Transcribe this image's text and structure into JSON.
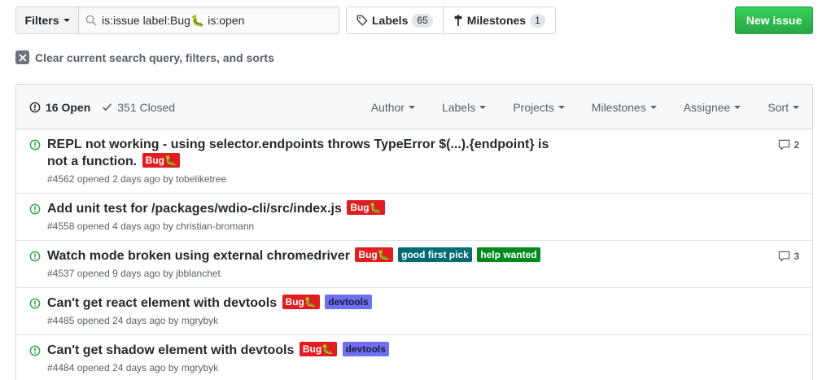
{
  "toolbar": {
    "filters_label": "Filters",
    "search_value": "is:issue label:Bug🐛 is:open",
    "labels_label": "Labels",
    "labels_count": "65",
    "milestones_label": "Milestones",
    "milestones_count": "1",
    "new_issue_label": "New issue"
  },
  "clear_query_label": "Clear current search query, filters, and sorts",
  "header": {
    "open_label": "16 Open",
    "closed_label": "351 Closed",
    "filters": [
      "Author",
      "Labels",
      "Projects",
      "Milestones",
      "Assignee",
      "Sort"
    ]
  },
  "issues": [
    {
      "title": "REPL not working - using selector.endpoints throws TypeError $(...).{endpoint} is not a function.",
      "labels": [
        {
          "text": "Bug🐛",
          "kind": "bug"
        }
      ],
      "number": "#4562",
      "opened": "opened 2 days ago by",
      "author": "tobeliketree",
      "comments": "2"
    },
    {
      "title": "Add unit test for /packages/wdio-cli/src/index.js",
      "labels": [
        {
          "text": "Bug🐛",
          "kind": "bug"
        }
      ],
      "number": "#4558",
      "opened": "opened 4 days ago by",
      "author": "christian-bromann",
      "comments": ""
    },
    {
      "title": "Watch mode broken using external chromedriver",
      "labels": [
        {
          "text": "Bug🐛",
          "kind": "bug"
        },
        {
          "text": "good first pick",
          "kind": "gfp"
        },
        {
          "text": "help wanted",
          "kind": "hw"
        }
      ],
      "number": "#4537",
      "opened": "opened 9 days ago by",
      "author": "jbblanchet",
      "comments": "3"
    },
    {
      "title": "Can't get react element with devtools",
      "labels": [
        {
          "text": "Bug🐛",
          "kind": "bug"
        },
        {
          "text": "devtools",
          "kind": "dev"
        }
      ],
      "number": "#4485",
      "opened": "opened 24 days ago by",
      "author": "mgrybyk",
      "comments": ""
    },
    {
      "title": "Can't get shadow element with devtools",
      "labels": [
        {
          "text": "Bug🐛",
          "kind": "bug"
        },
        {
          "text": "devtools",
          "kind": "dev"
        }
      ],
      "number": "#4484",
      "opened": "opened 24 days ago by",
      "author": "mgrybyk",
      "comments": ""
    }
  ],
  "colors": {
    "accent_green": "#28a745",
    "open_icon": "#28a745",
    "bug": "#e11d21",
    "good_first_pick": "#006b75",
    "help_wanted": "#008a1e",
    "devtools": "#6f6ff2"
  }
}
